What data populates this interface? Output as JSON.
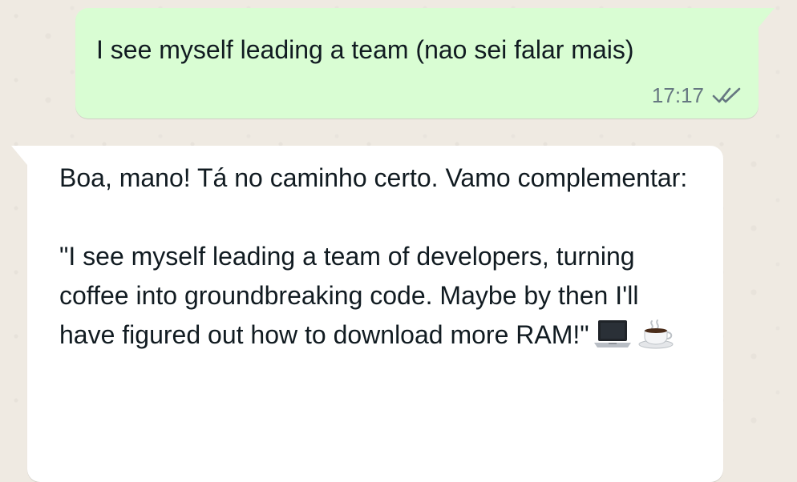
{
  "chat": {
    "outgoing": {
      "text": "I see myself leading a team (nao sei falar mais)",
      "time": "17:17",
      "status_icon": "double-check-icon"
    },
    "incoming": {
      "line1": "Boa, mano! Tá no caminho certo. Vamo complementar:",
      "line2": "\"I see myself leading a team of developers, turning coffee into groundbreaking code. Maybe by then I'll have figured out how to download more RAM!\"",
      "emojis": [
        "laptop-icon",
        "coffee-icon"
      ]
    }
  }
}
